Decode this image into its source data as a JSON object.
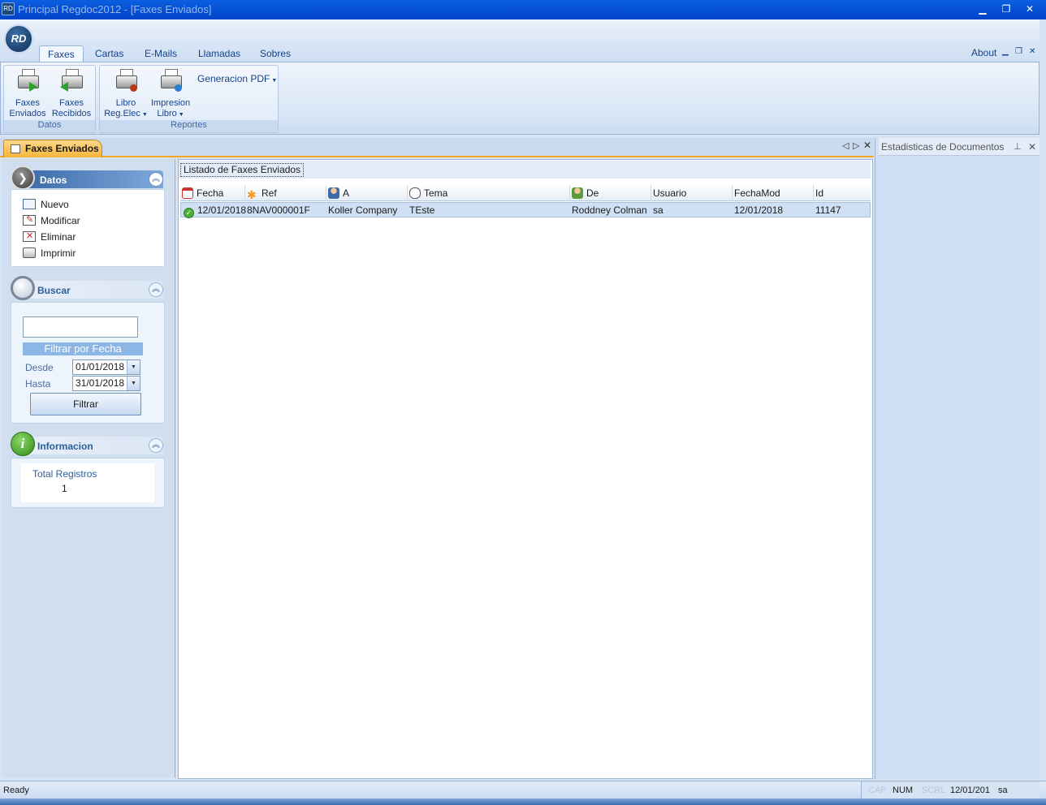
{
  "window": {
    "title": "Principal Regdoc2012 - [Faxes Enviados]",
    "app_icon": "RD",
    "controls": {
      "minimize": "▁",
      "restore": "❐",
      "close": "✕"
    }
  },
  "orb": {
    "label": "RD"
  },
  "ribbon": {
    "tabs": [
      {
        "label": "Faxes",
        "active": true
      },
      {
        "label": "Cartas"
      },
      {
        "label": "E-Mails"
      },
      {
        "label": "Llamadas"
      },
      {
        "label": "Sobres"
      }
    ],
    "about": "About",
    "mdi": {
      "min": "▁",
      "restore": "❐",
      "close": "✕"
    },
    "groups": {
      "datos": {
        "label": "Datos",
        "buttons": [
          {
            "line1": "Faxes",
            "line2": "Enviados"
          },
          {
            "line1": "Faxes",
            "line2": "Recibidos"
          }
        ]
      },
      "reportes": {
        "label": "Reportes",
        "buttons": [
          {
            "line1": "Libro",
            "line2": "Reg.Elec"
          },
          {
            "line1": "Impresion",
            "line2": "Libro"
          }
        ],
        "pdf": "Generacion PDF"
      }
    }
  },
  "doc_tab": {
    "label": "Faxes Enviados"
  },
  "left_panel": {
    "datos": {
      "title": "Datos",
      "tasks": [
        "Nuevo",
        "Modificar",
        "Eliminar",
        "Imprimir"
      ]
    },
    "buscar": {
      "title": "Buscar",
      "search_value": "",
      "filter_header": "Filtrar por Fecha",
      "desde_label": "Desde",
      "desde_value": "01/01/2018",
      "hasta_label": "Hasta",
      "hasta_value": "31/01/2018",
      "filter_button": "Filtrar"
    },
    "informacion": {
      "title": "Informacion",
      "total_label": "Total Registros",
      "total_value": "1"
    }
  },
  "list": {
    "caption": "Listado de Faxes Enviados",
    "columns": [
      "Fecha",
      "Ref",
      "A",
      "Tema",
      "De",
      "Usuario",
      "FechaMod",
      "Id"
    ],
    "rows": [
      {
        "fecha": "12/01/2018",
        "ref": "8NAV000001F",
        "a": "Koller Company",
        "tema": "TEste",
        "de": "Roddney Colman",
        "usuario": "sa",
        "fechamod": "12/01/2018",
        "id": "11147"
      }
    ]
  },
  "right_panel": {
    "title": "Estadisticas de Documentos"
  },
  "statusbar": {
    "ready": "Ready",
    "cap": "CAP",
    "num": "NUM",
    "scrl": "SCRL",
    "date": "12/01/201",
    "user": "sa"
  },
  "colors": {
    "accent": "#15428b",
    "doc_tab": "#f6b53a",
    "panel_header": "#4a7bb6",
    "selected_row": "#cfe0f5"
  }
}
